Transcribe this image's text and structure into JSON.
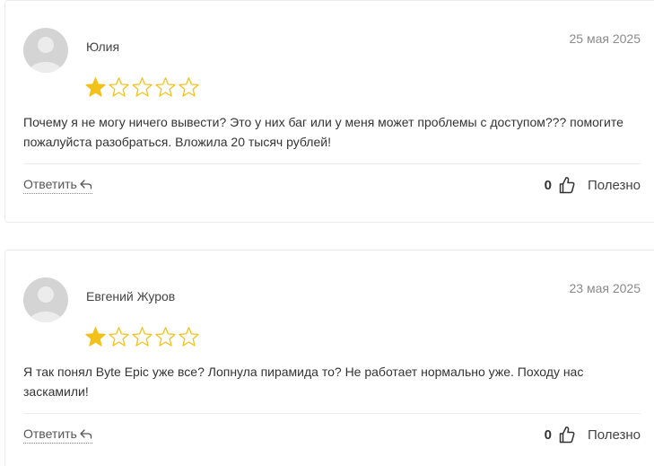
{
  "reviews": [
    {
      "author": "Юлия",
      "date": "25 мая 2025",
      "rating": 1,
      "max_rating": 5,
      "text": "Почему я не могу ничего вывести? Это у них баг или у меня может проблемы с доступом??? помогите пожалуйста разобраться. Вложила 20 тысяч рублей!",
      "reply_label": "Ответить",
      "helpful_count": "0",
      "helpful_label": "Полезно"
    },
    {
      "author": "Евгений Журов",
      "date": "23 мая 2025",
      "rating": 1,
      "max_rating": 5,
      "text": "Я так понял Byte Epic уже все? Лопнула пирамида то? Не работает нормально уже. Походу нас заскамили!",
      "reply_label": "Ответить",
      "helpful_count": "0",
      "helpful_label": "Полезно"
    }
  ],
  "colors": {
    "star_filled": "#F2C21B",
    "star_outline": "#F2C21B",
    "avatar_bg": "#D4D4D4",
    "avatar_fg": "#ECECEC"
  },
  "icons": {
    "avatar": "avatar-placeholder-icon",
    "star_filled": "star-filled-icon",
    "star_empty": "star-outline-icon",
    "reply": "reply-arrow-icon",
    "thumb": "thumbs-up-icon"
  }
}
